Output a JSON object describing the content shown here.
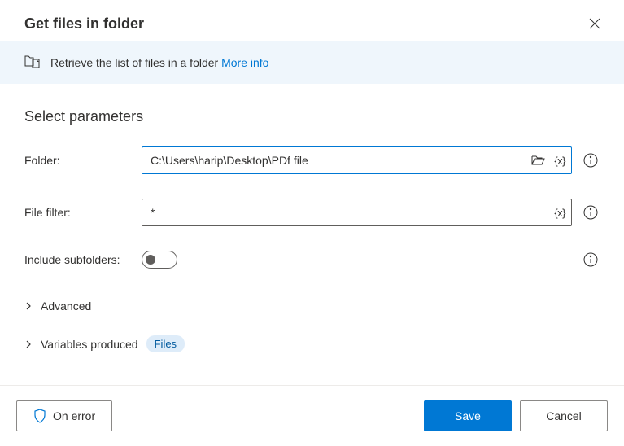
{
  "header": {
    "title": "Get files in folder",
    "close_label": "Close"
  },
  "banner": {
    "text": "Retrieve the list of files in a folder",
    "link": "More info"
  },
  "section": {
    "title": "Select parameters"
  },
  "form": {
    "folder": {
      "label": "Folder:",
      "value": "C:\\Users\\harip\\Desktop\\PDf file"
    },
    "filter": {
      "label": "File filter:",
      "value": "*"
    },
    "subfolders": {
      "label": "Include subfolders:",
      "enabled": false
    },
    "var_token": "{x}"
  },
  "expandables": {
    "advanced": "Advanced",
    "variables": "Variables produced",
    "variables_badge": "Files"
  },
  "footer": {
    "on_error": "On error",
    "save": "Save",
    "cancel": "Cancel"
  }
}
